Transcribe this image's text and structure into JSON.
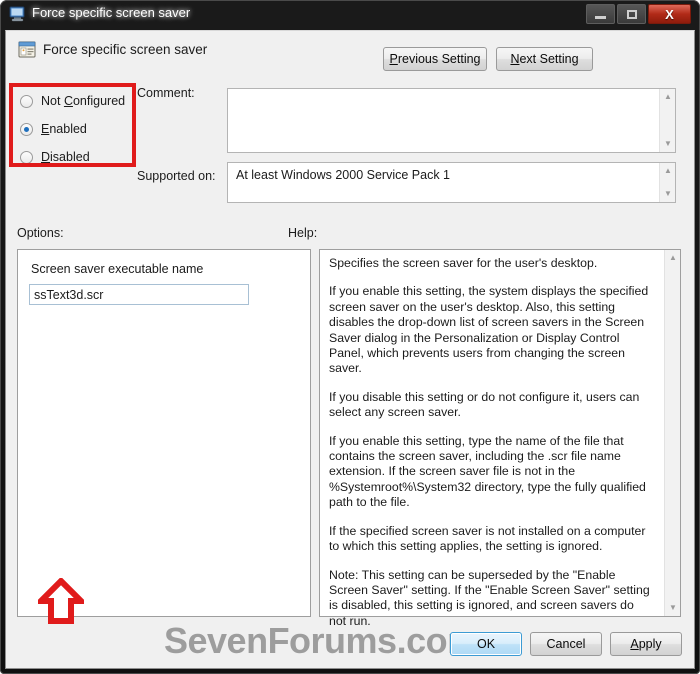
{
  "window": {
    "title": "Force specific screen saver",
    "title_icon": "monitor-icon",
    "controls": {
      "minimize": "minimize-icon",
      "maximize": "maximize-icon",
      "close": "close-icon",
      "close_glyph": "X"
    }
  },
  "header": {
    "icon": "policy-setting-icon",
    "title": "Force specific screen saver",
    "previous_setting": "Previous Setting",
    "previous_accel": "P",
    "next_setting": "Next Setting",
    "next_accel": "N"
  },
  "state": {
    "label_comment": "Comment:",
    "comment_value": "",
    "label_supported": "Supported on:",
    "supported_value": "At least Windows 2000 Service Pack 1",
    "radios": [
      {
        "label_pre": "Not ",
        "accel": "C",
        "label_post": "onfigured",
        "selected": false,
        "name": "not-configured"
      },
      {
        "label_pre": "",
        "accel": "E",
        "label_post": "nabled",
        "selected": true,
        "name": "enabled"
      },
      {
        "label_pre": "",
        "accel": "D",
        "label_post": "isabled",
        "selected": false,
        "name": "disabled"
      }
    ]
  },
  "options": {
    "label": "Options:",
    "field_label": "Screen saver executable name",
    "field_value": "ssText3d.scr",
    "field_placeholder": ""
  },
  "help": {
    "label": "Help:",
    "paragraphs": [
      "Specifies the screen saver for the user's desktop.",
      "If you enable this setting, the system displays the specified screen saver on the user's desktop. Also, this setting disables the drop-down list of screen savers in the Screen Saver dialog in the Personalization or Display Control Panel, which prevents users from changing the screen saver.",
      "If you disable this setting or do not configure it, users can select any screen saver.",
      "If you enable this setting, type the name of the file that contains the screen saver, including the .scr file name extension. If the screen saver file is not in the %Systemroot%\\System32 directory, type the fully qualified path to the file.",
      "If the specified screen saver is not installed on a computer to which this setting applies, the setting is ignored.",
      "Note: This setting can be superseded by the \"Enable Screen Saver\" setting.  If the \"Enable Screen Saver\" setting is disabled, this setting is ignored, and screen savers do not run."
    ]
  },
  "footer": {
    "ok": "OK",
    "cancel": "Cancel",
    "apply_pre": "",
    "apply_accel": "A",
    "apply_post": "pply"
  },
  "watermark": {
    "text": "SevenForums.com"
  },
  "annotations": {
    "radio_box_color": "#e01b1b",
    "arrow_color": "#e01b1b",
    "arrow_direction": "up"
  },
  "colors": {
    "dialog_bg": "#f0f0f0",
    "titlebar_bg": "#141414",
    "panel_bg": "#ffffff",
    "accent": "#1e6fbd",
    "close_button": "#b12a18"
  }
}
